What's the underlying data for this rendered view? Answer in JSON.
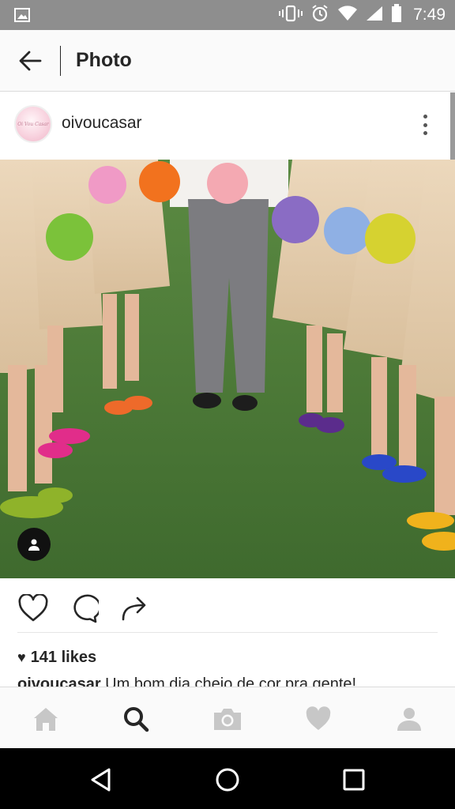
{
  "status_bar": {
    "time": "7:49",
    "icons": [
      "image-icon",
      "vibrate-icon",
      "alarm-icon",
      "wifi-icon",
      "signal-icon",
      "battery-icon"
    ]
  },
  "header": {
    "back_icon": "arrow-left-icon",
    "title": "Photo"
  },
  "post": {
    "username": "oivoucasar",
    "avatar_text": "Oi Vou Casar",
    "more_icon": "more-vertical-icon",
    "tag_icon": "user-tag-icon",
    "actions": [
      "heart-icon",
      "comment-icon",
      "share-icon"
    ],
    "likes": "141 likes",
    "caption_user": "oivoucasar",
    "caption_text": " Um bom dia cheio de cor pra gente!"
  },
  "tab_bar": {
    "tabs": [
      "home-icon",
      "search-icon",
      "camera-icon",
      "heart-icon",
      "profile-icon"
    ],
    "active": "search-icon"
  },
  "nav_bar": {
    "buttons": [
      "back-triangle-icon",
      "home-circle-icon",
      "recents-square-icon"
    ]
  },
  "colors": {
    "status_bar": "#8e8e8e",
    "header_bg": "#fafafa",
    "text": "#262626",
    "grass": "#4e7a3a",
    "dress": "#e8d2b4"
  }
}
